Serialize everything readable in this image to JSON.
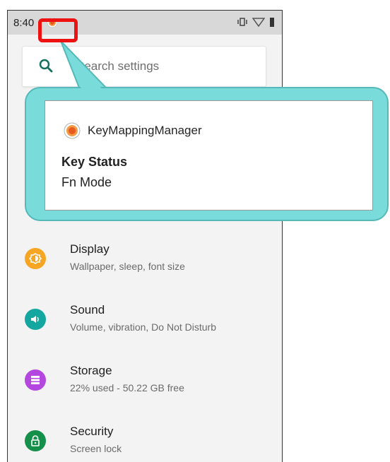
{
  "statusbar": {
    "time": "8:40"
  },
  "search": {
    "placeholder": "Search settings"
  },
  "notification": {
    "app_name": "KeyMappingManager",
    "title": "Key Status",
    "text": "Fn Mode"
  },
  "settings": {
    "items": [
      {
        "title": "Display",
        "subtitle": "Wallpaper, sleep, font size",
        "icon": "display-icon",
        "color": "#f6a623"
      },
      {
        "title": "Sound",
        "subtitle": "Volume, vibration, Do Not Disturb",
        "icon": "sound-icon",
        "color": "#14a7a0"
      },
      {
        "title": "Storage",
        "subtitle": "22% used - 50.22 GB free",
        "icon": "storage-icon",
        "color": "#b347e0"
      },
      {
        "title": "Security",
        "subtitle": "Screen lock",
        "icon": "lock-icon",
        "color": "#14904a"
      }
    ]
  },
  "colors": {
    "highlight": "#ee1111",
    "callout": "#79dcdb",
    "search_icon": "#14705e"
  }
}
